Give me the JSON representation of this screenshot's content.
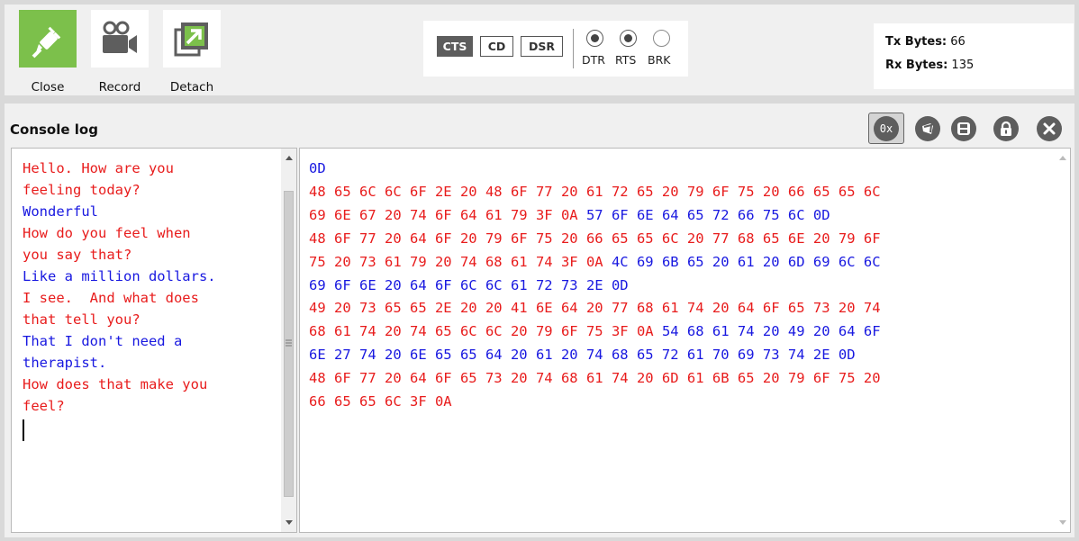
{
  "toolbar": {
    "buttons": [
      {
        "label": "Close",
        "icon": "plug-icon",
        "active": true
      },
      {
        "label": "Record",
        "icon": "camera-icon"
      },
      {
        "label": "Detach",
        "icon": "detach-icon"
      }
    ],
    "lines": {
      "badges": [
        {
          "label": "CTS",
          "on": true
        },
        {
          "label": "CD",
          "on": false
        },
        {
          "label": "DSR",
          "on": false
        }
      ],
      "toggles": [
        {
          "label": "DTR",
          "on": true
        },
        {
          "label": "RTS",
          "on": true
        },
        {
          "label": "BRK",
          "on": false
        }
      ]
    },
    "stats": {
      "tx_label": "Tx Bytes:",
      "tx_value": "66",
      "rx_label": "Rx Bytes:",
      "rx_value": "135"
    }
  },
  "console": {
    "title": "Console log",
    "hex_toggle_label": "0x",
    "actions": [
      "clear-icon",
      "save-icon",
      "lock-icon",
      "close-icon"
    ],
    "text_lines": [
      {
        "text": "Hello. How are you",
        "color": "red"
      },
      {
        "text": "feeling today?",
        "color": "red"
      },
      {
        "text": "Wonderful",
        "color": "blue"
      },
      {
        "text": "How do you feel when",
        "color": "red"
      },
      {
        "text": "you say that?",
        "color": "red"
      },
      {
        "text": "Like a million dollars.",
        "color": "blue"
      },
      {
        "text": "I see.  And what does",
        "color": "red"
      },
      {
        "text": "that tell you?",
        "color": "red"
      },
      {
        "text": "That I don't need a",
        "color": "blue"
      },
      {
        "text": "therapist.",
        "color": "blue"
      },
      {
        "text": "How does that make you",
        "color": "red"
      },
      {
        "text": "feel?",
        "color": "red"
      }
    ],
    "hex_lines": [
      [
        {
          "t": "0D",
          "c": "blue"
        }
      ],
      [
        {
          "t": "48 65 6C 6C 6F 2E 20 48 6F 77 20 61 72 65 20 79 6F 75 20 66 65 65 6C",
          "c": "red"
        }
      ],
      [
        {
          "t": "69 6E 67 20 74 6F 64 61 79 3F 0A ",
          "c": "red"
        },
        {
          "t": "57 6F 6E 64 65 72 66 75 6C 0D",
          "c": "blue"
        }
      ],
      [
        {
          "t": "48 6F 77 20 64 6F 20 79 6F 75 20 66 65 65 6C 20 77 68 65 6E 20 79 6F",
          "c": "red"
        }
      ],
      [
        {
          "t": "75 20 73 61 79 20 74 68 61 74 3F 0A ",
          "c": "red"
        },
        {
          "t": "4C 69 6B 65 20 61 20 6D 69 6C 6C",
          "c": "blue"
        }
      ],
      [
        {
          "t": "69 6F 6E 20 64 6F 6C 6C 61 72 73 2E 0D",
          "c": "blue"
        }
      ],
      [
        {
          "t": "49 20 73 65 65 2E 20 20 41 6E 64 20 77 68 61 74 20 64 6F 65 73 20 74",
          "c": "red"
        }
      ],
      [
        {
          "t": "68 61 74 20 74 65 6C 6C 20 79 6F 75 3F 0A ",
          "c": "red"
        },
        {
          "t": "54 68 61 74 20 49 20 64 6F",
          "c": "blue"
        }
      ],
      [
        {
          "t": "6E 27 74 20 6E 65 65 64 20 61 20 74 68 65 72 61 70 69 73 74 2E 0D",
          "c": "blue"
        }
      ],
      [
        {
          "t": "48 6F 77 20 64 6F 65 73 20 74 68 61 74 20 6D 61 6B 65 20 79 6F 75 20",
          "c": "red"
        }
      ],
      [
        {
          "t": "66 65 65 6C 3F 0A",
          "c": "red"
        }
      ]
    ]
  },
  "colors": {
    "red": "#e81c1c",
    "blue": "#1818e0",
    "active_green": "#7cc04b",
    "icon_dark": "#5e5e5e"
  }
}
